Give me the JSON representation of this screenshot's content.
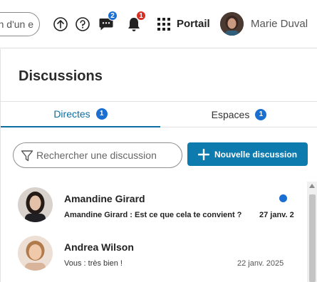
{
  "header": {
    "search_partial_text": "n d'un e",
    "upload_icon": "arrow-up-circle-icon",
    "help_icon": "question-circle-icon",
    "chat_icon": "chat-bubble-icon",
    "chat_badge": "2",
    "notifications_icon": "bell-icon",
    "notifications_badge": "1",
    "apps_icon": "grid-icon",
    "portal_label": "Portail",
    "user_name": "Marie Duval"
  },
  "panel": {
    "title": "Discussions",
    "tabs": [
      {
        "label": "Directes",
        "count": "1",
        "active": true
      },
      {
        "label": "Espaces",
        "count": "1",
        "active": false
      }
    ],
    "search_placeholder": "Rechercher une discussion",
    "new_button_label": "Nouvelle discussion"
  },
  "conversations": [
    {
      "name": "Amandine Girard",
      "preview": "Amandine Girard : Est ce que cela te convient ?",
      "date": "27 janv. 2",
      "unread": true
    },
    {
      "name": "Andrea Wilson",
      "preview": "Vous : très bien !",
      "date": "22 janv. 2025",
      "unread": false
    }
  ],
  "colors": {
    "accent": "#0d7bae",
    "tab_active": "#0d6ea1",
    "badge_blue": "#1b6fd1",
    "badge_red": "#d93025"
  }
}
